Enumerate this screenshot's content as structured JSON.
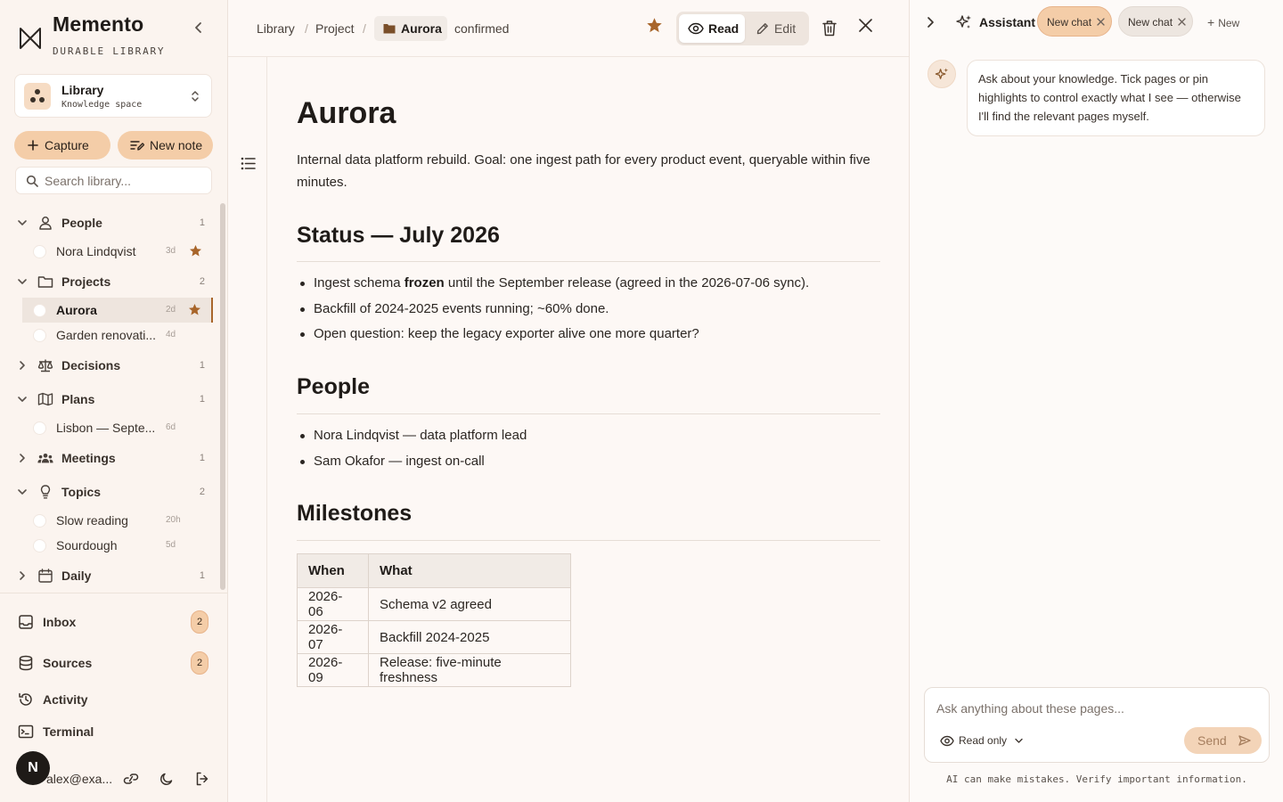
{
  "app": {
    "name": "Memento",
    "tagline": "DURABLE LIBRARY"
  },
  "space": {
    "name": "Library",
    "type": "Knowledge space"
  },
  "actions": {
    "capture": "Capture",
    "new_note": "New note"
  },
  "search": {
    "placeholder": "Search library..."
  },
  "tree": {
    "people": {
      "label": "People",
      "count": "1",
      "items": [
        {
          "label": "Nora Lindqvist",
          "age": "3d"
        }
      ]
    },
    "projects": {
      "label": "Projects",
      "count": "2",
      "items": [
        {
          "label": "Aurora",
          "age": "2d"
        },
        {
          "label": "Garden renovati...",
          "age": "4d"
        }
      ]
    },
    "decisions": {
      "label": "Decisions",
      "count": "1"
    },
    "plans": {
      "label": "Plans",
      "count": "1",
      "items": [
        {
          "label": "Lisbon — Septe...",
          "age": "6d"
        }
      ]
    },
    "meetings": {
      "label": "Meetings",
      "count": "1"
    },
    "topics": {
      "label": "Topics",
      "count": "2",
      "items": [
        {
          "label": "Slow reading",
          "age": "20h"
        },
        {
          "label": "Sourdough",
          "age": "5d"
        }
      ]
    },
    "daily": {
      "label": "Daily",
      "count": "1"
    }
  },
  "nav": {
    "inbox": {
      "label": "Inbox",
      "badge": "2"
    },
    "sources": {
      "label": "Sources",
      "badge": "2"
    },
    "activity": {
      "label": "Activity"
    },
    "terminal": {
      "label": "Terminal"
    }
  },
  "user": {
    "initial": "N",
    "email": "alex@exa..."
  },
  "breadcrumb": {
    "library": "Library",
    "project": "Project",
    "current": "Aurora",
    "status": "confirmed"
  },
  "modes": {
    "read": "Read",
    "edit": "Edit"
  },
  "doc": {
    "title": "Aurora",
    "lead": "Internal data platform rebuild. Goal: one ingest path for every product event, queryable within five minutes.",
    "status": {
      "heading": "Status — July 2026",
      "b1_pre": "Ingest schema ",
      "b1_bold": "frozen",
      "b1_post": " until the September release (agreed in the 2026-07-06 sync).",
      "b2": "Backfill of 2024-2025 events running; ~60% done.",
      "b3": "Open question: keep the legacy exporter alive one more quarter?"
    },
    "people": {
      "heading": "People",
      "items": [
        "Nora Lindqvist — data platform lead",
        "Sam Okafor — ingest on-call"
      ]
    },
    "milestones": {
      "heading": "Milestones",
      "col_when": "When",
      "col_what": "What",
      "rows": [
        {
          "when": "2026-06",
          "what": "Schema v2 agreed"
        },
        {
          "when": "2026-07",
          "what": "Backfill 2024-2025"
        },
        {
          "when": "2026-09",
          "what": "Release: five-minute freshness"
        }
      ]
    }
  },
  "assistant": {
    "title": "Assistant",
    "tabs": [
      "New chat",
      "New chat"
    ],
    "new_label": "New",
    "greeting": "Ask about your knowledge. Tick pages or pin highlights to control exactly what I see — otherwise I'll find the relevant pages myself.",
    "input_placeholder": "Ask anything about these pages...",
    "mode": "Read only",
    "send": "Send",
    "disclaimer": "AI can make mistakes. Verify important information."
  },
  "colors": {
    "accent": "#a8652a",
    "pill": "#f4cda8",
    "background": "#fdf8f5"
  }
}
